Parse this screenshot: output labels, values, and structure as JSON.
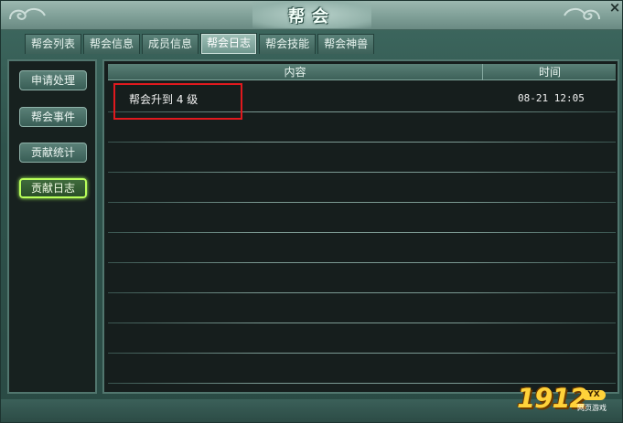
{
  "window": {
    "title": "帮会",
    "close_label": "×"
  },
  "tabs": [
    {
      "label": "帮会列表",
      "active": false
    },
    {
      "label": "帮会信息",
      "active": false
    },
    {
      "label": "成员信息",
      "active": false
    },
    {
      "label": "帮会日志",
      "active": true
    },
    {
      "label": "帮会技能",
      "active": false
    },
    {
      "label": "帮会神兽",
      "active": false
    }
  ],
  "sidebar": {
    "items": [
      {
        "label": "申请处理",
        "active": false
      },
      {
        "label": "帮会事件",
        "active": false
      },
      {
        "label": "贡献统计",
        "active": false
      },
      {
        "label": "贡献日志",
        "active": true
      }
    ]
  },
  "log_table": {
    "columns": {
      "content": "内容",
      "time": "时间"
    },
    "rows": [
      {
        "content": "帮会升到 4 级",
        "time": "08-21 12:05"
      }
    ]
  },
  "watermark": {
    "number": "1912",
    "badge": "YX",
    "subtitle": "网页游戏"
  },
  "colors": {
    "highlight": "#e0191e",
    "active_glow": "#b9ff5a"
  },
  "icons": {
    "close": "close-icon",
    "ornament": "cloud-swirl-icon"
  }
}
